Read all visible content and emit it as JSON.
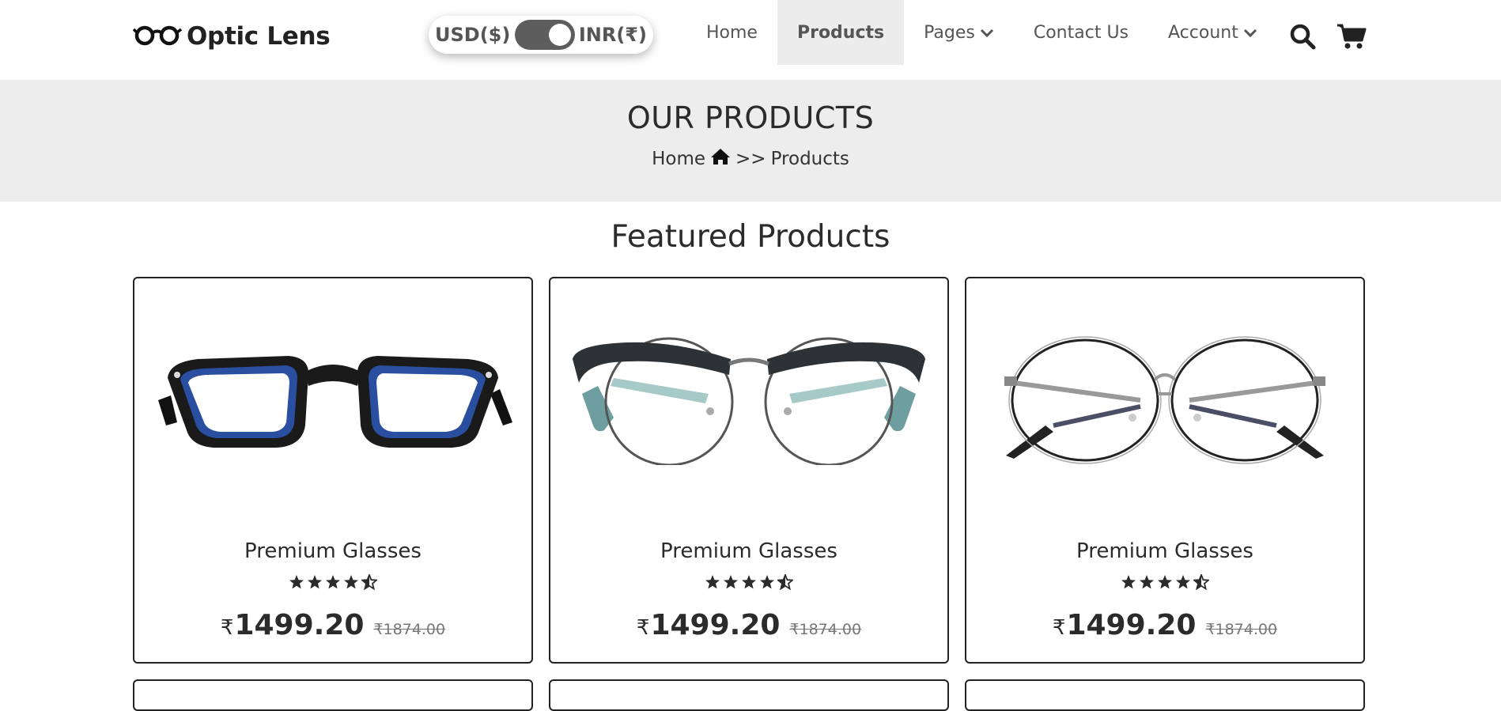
{
  "brand": {
    "name": "Optic Lens"
  },
  "currency_toggle": {
    "left_label": "USD($)",
    "right_label": "INR(₹)",
    "selected": "INR(₹)"
  },
  "nav": {
    "items": [
      {
        "label": "Home",
        "active": false,
        "dropdown": false
      },
      {
        "label": "Products",
        "active": true,
        "dropdown": false
      },
      {
        "label": "Pages",
        "active": false,
        "dropdown": true
      },
      {
        "label": "Contact Us",
        "active": false,
        "dropdown": false
      },
      {
        "label": "Account",
        "active": false,
        "dropdown": true
      }
    ],
    "icons": [
      "search-icon",
      "cart-icon"
    ]
  },
  "banner": {
    "title": "OUR PRODUCTS",
    "breadcrumb": {
      "home": "Home",
      "separator": ">>",
      "current": "Products"
    }
  },
  "featured": {
    "title": "Featured Products",
    "products": [
      {
        "name": "Premium Glasses",
        "rating": 4.5,
        "currency": "₹",
        "price": "1499.20",
        "old_price": "₹1874.00",
        "frame_style": "black-blue-wayfarer"
      },
      {
        "name": "Premium Glasses",
        "rating": 4.5,
        "currency": "₹",
        "price": "1499.20",
        "old_price": "₹1874.00",
        "frame_style": "teal-browline-round"
      },
      {
        "name": "Premium Glasses",
        "rating": 4.5,
        "currency": "₹",
        "price": "1499.20",
        "old_price": "₹1874.00",
        "frame_style": "silver-wire-round"
      }
    ]
  },
  "colors": {
    "banner_bg": "#ededed",
    "active_nav_bg": "#ececec",
    "text": "#2b2b2b",
    "toggle": "#5d5d5d"
  }
}
